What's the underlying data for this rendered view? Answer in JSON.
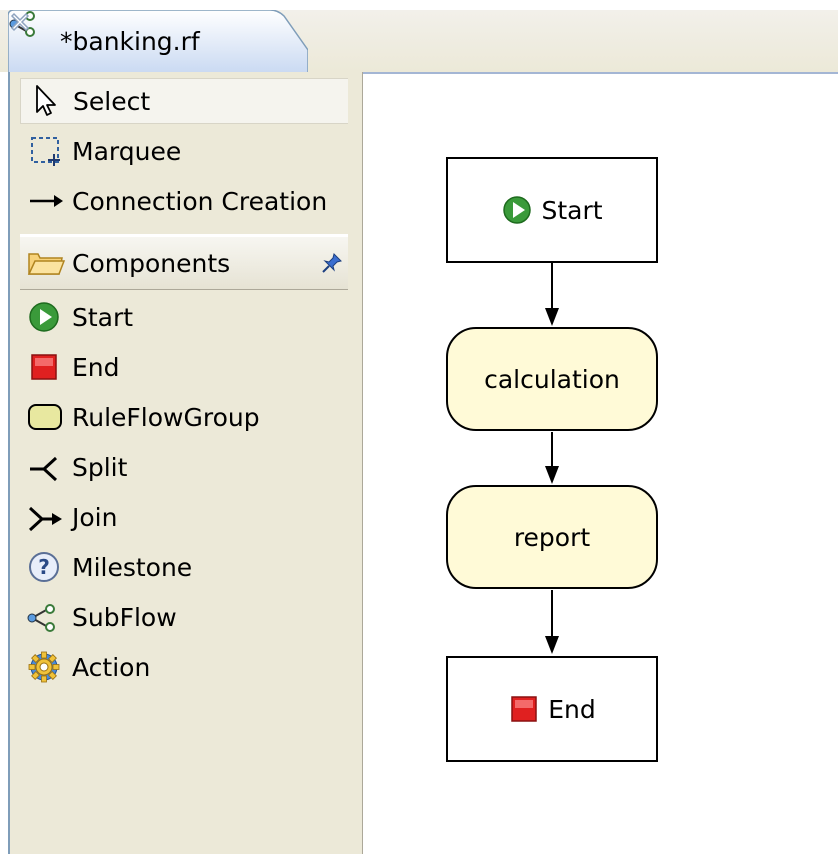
{
  "editor_tab": {
    "title": "*banking.rf",
    "icon": "subflow-icon"
  },
  "palette": {
    "tools": [
      {
        "label": "Select",
        "icon": "select-arrow-icon",
        "selected": true
      },
      {
        "label": "Marquee",
        "icon": "marquee-icon"
      },
      {
        "label": "Connection Creation",
        "icon": "connection-arrow-icon"
      }
    ],
    "drawer": {
      "label": "Components",
      "icon": "folder-open-icon",
      "pin_icon": "pin-icon"
    },
    "components": [
      {
        "label": "Start",
        "icon": "start-icon"
      },
      {
        "label": "End",
        "icon": "end-icon"
      },
      {
        "label": "RuleFlowGroup",
        "icon": "ruleflowgroup-icon"
      },
      {
        "label": "Split",
        "icon": "split-icon"
      },
      {
        "label": "Join",
        "icon": "join-icon"
      },
      {
        "label": "Milestone",
        "icon": "milestone-icon"
      },
      {
        "label": "SubFlow",
        "icon": "subflow-icon"
      },
      {
        "label": "Action",
        "icon": "action-gear-icon"
      }
    ]
  },
  "diagram": {
    "nodes": [
      {
        "label": "Start",
        "kind": "start",
        "icon": "start-icon"
      },
      {
        "label": "calculation",
        "kind": "ruleflowgroup"
      },
      {
        "label": "report",
        "kind": "ruleflowgroup"
      },
      {
        "label": "End",
        "kind": "end",
        "icon": "end-icon"
      }
    ]
  },
  "colors": {
    "ruleflowgroup_fill": "#fffad7",
    "palette_bg": "#ece9d8",
    "start_green": "#3a9a3a",
    "end_red": "#e02020"
  }
}
